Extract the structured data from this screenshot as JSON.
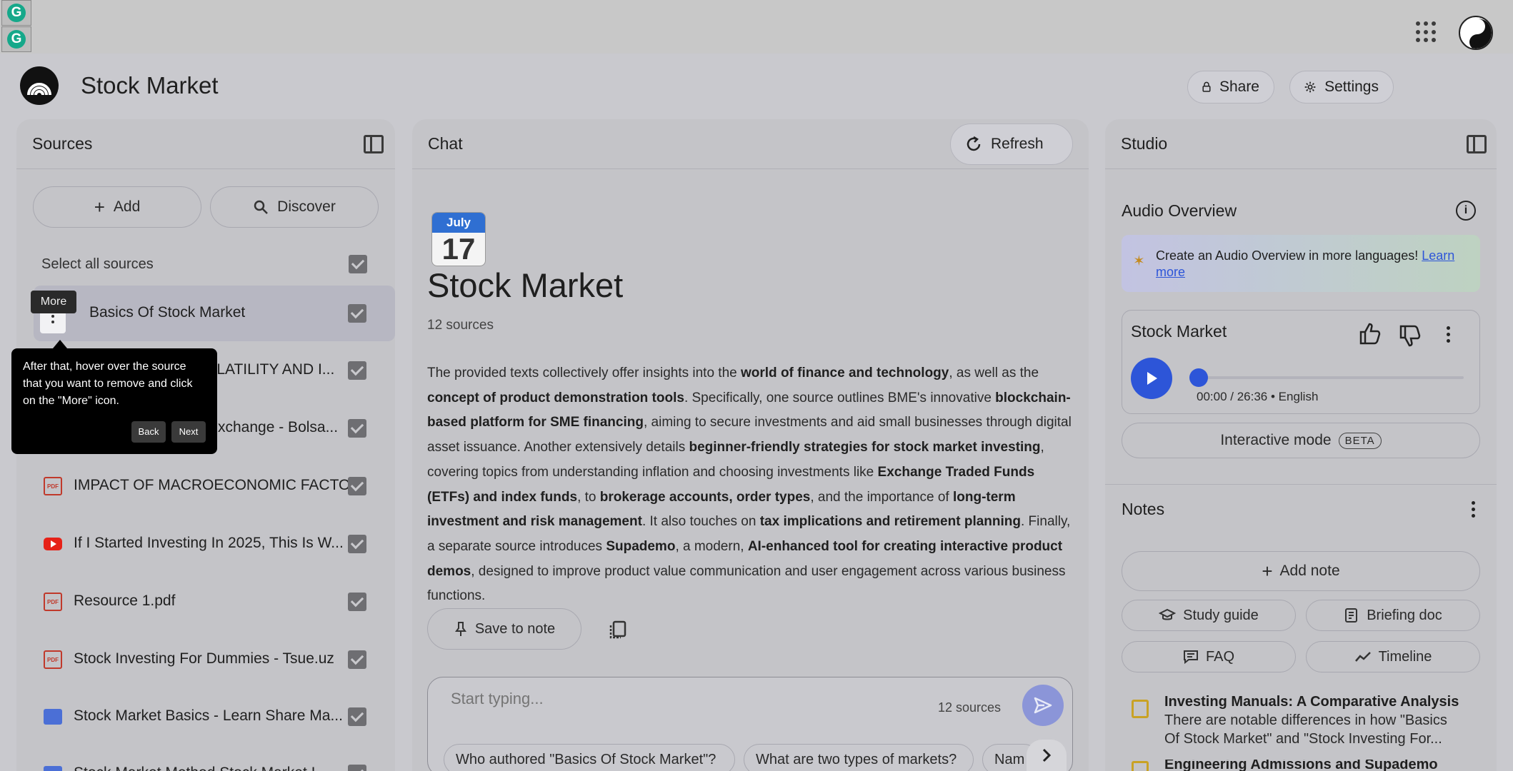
{
  "app": {
    "title": "Stock Market"
  },
  "header": {
    "share_label": "Share",
    "settings_label": "Settings"
  },
  "sources": {
    "title": "Sources",
    "add_label": "Add",
    "discover_label": "Discover",
    "select_all_label": "Select all sources",
    "items": [
      {
        "label": "Basics Of Stock Market",
        "icon": "more-icon"
      },
      {
        "label": "OLATILITY AND I...",
        "icon": "pdf-icon"
      },
      {
        "label": "xchange - Bolsa...",
        "icon": "pdf-icon"
      },
      {
        "label": "IMPACT OF MACROECONOMIC FACTO...",
        "icon": "pdf-icon"
      },
      {
        "label": "If I Started Investing In 2025, This Is W...",
        "icon": "youtube-icon"
      },
      {
        "label": "Resource 1.pdf",
        "icon": "pdf-icon"
      },
      {
        "label": "Stock Investing For Dummies - Tsue.uz",
        "icon": "pdf-icon"
      },
      {
        "label": "Stock Market Basics - Learn Share Ma...",
        "icon": "web-icon"
      },
      {
        "label": "Stock Market Method Stock Market I...",
        "icon": "web-icon"
      }
    ],
    "tooltip_more": "More",
    "guide": {
      "text": "After that, hover over the source that you want to remove and click on the \"More\" icon.",
      "back_label": "Back",
      "next_label": "Next"
    }
  },
  "chat": {
    "title": "Chat",
    "refresh_label": "Refresh",
    "calendar_month": "July",
    "calendar_day": "17",
    "notebook_title": "Stock Market",
    "source_count": "12 sources",
    "summary": {
      "p1": "The provided texts collectively offer insights into the ",
      "b1": "world of finance and technology",
      "p2": ", as well as the ",
      "b2": "concept of product demonstration tools",
      "p3": ". Specifically, one source outlines BME's innovative ",
      "b3": "blockchain-based platform for SME financing",
      "p4": ", aiming to secure investments and aid small businesses through digital asset issuance. Another extensively details ",
      "b4": "beginner-friendly strategies for stock market investing",
      "p5": ", covering topics from understanding inflation and choosing investments like ",
      "b5": "Exchange Traded Funds (ETFs) and index funds",
      "p6": ", to ",
      "b6": "brokerage accounts, order types",
      "p7": ", and the importance of ",
      "b7": "long-term investment and risk management",
      "p8": ". It also touches on ",
      "b8": "tax implications and retirement planning",
      "p9": ". Finally, a separate source introduces ",
      "b9": "Supademo",
      "p10": ", a modern, ",
      "b10": "AI-enhanced tool for creating interactive product demos",
      "p11": ", designed to improve product value communication and user engagement across various business functions."
    },
    "save_to_note_label": "Save to note",
    "input_placeholder": "Start typing...",
    "input_source_count": "12 sources",
    "suggestions": [
      "Who authored \"Basics Of Stock Market\"?",
      "What are two types of markets?",
      "Nam"
    ]
  },
  "studio": {
    "title": "Studio",
    "audio_overview_title": "Audio Overview",
    "banner_text": "Create an Audio Overview in more languages! ",
    "banner_link": "Learn more",
    "audio_card_title": "Stock Market",
    "audio_time": "00:00 / 26:36 • English",
    "audio_progress": 0,
    "interactive_mode_label": "Interactive mode",
    "beta_label": "BETA",
    "notes_title": "Notes",
    "add_note_label": "Add note",
    "study_guide_label": "Study guide",
    "briefing_doc_label": "Briefing doc",
    "faq_label": "FAQ",
    "timeline_label": "Timeline",
    "notes": [
      {
        "title": "Investing Manuals: A Comparative Analysis",
        "preview": "There are notable differences in how \"Basics Of Stock Market\" and \"Stock Investing For..."
      },
      {
        "title": "Engineering Admissions and Supademo",
        "preview": ""
      }
    ]
  },
  "colors": {
    "accent": "#2d55d8",
    "background": "#c9c9ce",
    "panel": "#c4c4c8"
  }
}
